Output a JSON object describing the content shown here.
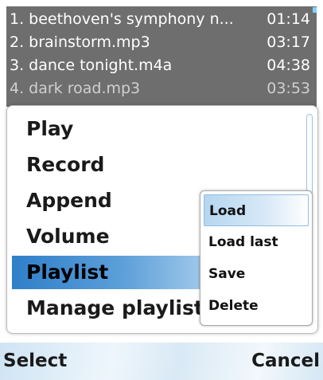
{
  "playlist": {
    "tracks": [
      {
        "title": "1. beethoven's symphony n...",
        "time": "01:14"
      },
      {
        "title": "2. brainstorm.mp3",
        "time": "03:17"
      },
      {
        "title": "3. dance tonight.m4a",
        "time": "04:38"
      },
      {
        "title": "4. dark road.mp3",
        "time": "03:53"
      }
    ]
  },
  "menu": {
    "items": [
      {
        "label": "Play"
      },
      {
        "label": "Record"
      },
      {
        "label": "Append"
      },
      {
        "label": "Volume"
      },
      {
        "label": "Playlist"
      },
      {
        "label": "Manage playlist"
      }
    ],
    "selected": "Playlist"
  },
  "submenu": {
    "items": [
      {
        "label": "Load"
      },
      {
        "label": "Load last"
      },
      {
        "label": "Save"
      },
      {
        "label": "Delete"
      }
    ],
    "selected": "Load"
  },
  "softkeys": {
    "left": "Select",
    "right": "Cancel"
  },
  "colors": {
    "selection_accent": "#2f7fc9",
    "submenu_selection": "#b5d6f0",
    "list_background": "#6e6e6e"
  }
}
